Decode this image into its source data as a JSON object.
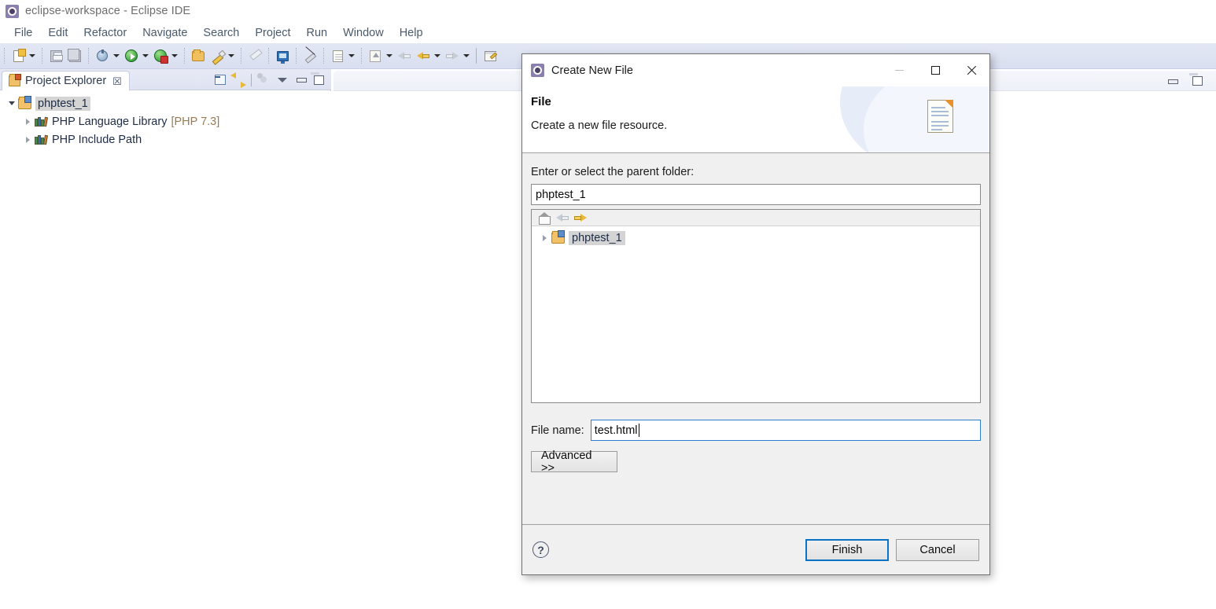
{
  "window": {
    "title": "eclipse-workspace - Eclipse IDE",
    "app_icon": "eclipse-icon"
  },
  "menubar": {
    "items": [
      {
        "label": "File"
      },
      {
        "label": "Edit"
      },
      {
        "label": "Refactor"
      },
      {
        "label": "Navigate"
      },
      {
        "label": "Search"
      },
      {
        "label": "Project"
      },
      {
        "label": "Run"
      },
      {
        "label": "Window"
      },
      {
        "label": "Help"
      }
    ]
  },
  "toolbar": {
    "icons": [
      "new-file-icon",
      "new-file-dropdown",
      "save-icon",
      "save-all-icon",
      "debug-icon",
      "debug-dropdown",
      "run-icon",
      "run-dropdown",
      "run-external-icon",
      "run-external-dropdown",
      "open-folder-icon",
      "pencil-icon",
      "pencil-dropdown",
      "ruler-icon",
      "monitor-icon",
      "no-pen-icon",
      "open-resource-icon",
      "open-resource-dropdown",
      "up-arrow-icon",
      "up-arrow-dropdown",
      "back-grey-icon",
      "back-yellow-icon",
      "back-dropdown",
      "forward-grey-icon",
      "forward-dropdown",
      "edit-page-icon"
    ]
  },
  "project_explorer": {
    "tab_label": "Project Explorer",
    "tab_icon": "project-explorer-icon",
    "tab_close": "☒",
    "tools": [
      "collapse-all-icon",
      "link-with-editor-icon",
      "view-menu-icon",
      "chevron-down-icon",
      "minimize-icon",
      "maximize-icon"
    ],
    "tree": [
      {
        "label": "phptest_1",
        "icon": "project-folder-icon",
        "expanded": true,
        "selected": true,
        "suffix": "",
        "indent": 0
      },
      {
        "label": "PHP Language Library",
        "icon": "library-books-icon",
        "expanded": false,
        "selected": false,
        "suffix": "[PHP 7.3]",
        "indent": 1
      },
      {
        "label": "PHP Include Path",
        "icon": "library-books-icon",
        "expanded": false,
        "selected": false,
        "suffix": "",
        "indent": 1
      }
    ]
  },
  "editor_area": {
    "tools": [
      "minimize-icon",
      "maximize-icon"
    ]
  },
  "dialog": {
    "title": "Create New File",
    "icon": "eclipse-icon",
    "window_buttons": {
      "minimize": "minimize-icon",
      "maximize": "maximize-icon",
      "close": "close-icon"
    },
    "banner": {
      "heading": "File",
      "description": "Create a new file resource.",
      "icon": "new-file-document-icon"
    },
    "parent_folder": {
      "label": "Enter or select the parent folder:",
      "value": "phptest_1",
      "placeholder": ""
    },
    "tree_toolbar": {
      "icons": [
        "home-icon",
        "back-arrow-icon",
        "forward-arrow-icon"
      ]
    },
    "tree": [
      {
        "label": "phptest_1",
        "icon": "project-folder-icon",
        "expanded": false,
        "selected": true
      }
    ],
    "file_name": {
      "label": "File name:",
      "value": "test.html",
      "placeholder": "",
      "focused": true
    },
    "advanced_button": "Advanced >>",
    "footer": {
      "help_icon": "help-icon",
      "help_glyph": "?",
      "finish_button": "Finish",
      "cancel_button": "Cancel",
      "default_button": "Finish"
    }
  },
  "colors": {
    "toolbar_bg": "#dfe3f1",
    "accent_focus": "#0a72c4",
    "selection_grey": "#d4d4d4",
    "tree_text": "#1d2b45",
    "suffix_text": "#9a7a50",
    "dialog_bg": "#f0f0f0"
  }
}
